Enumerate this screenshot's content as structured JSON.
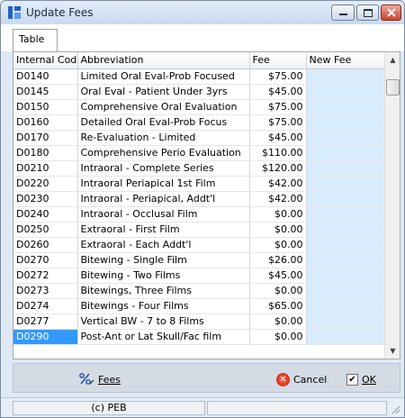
{
  "window": {
    "title": "Update Fees"
  },
  "tabs": [
    {
      "label": "Table"
    }
  ],
  "grid": {
    "columns": [
      "Internal Code",
      "Abbreviation",
      "Fee",
      "New Fee"
    ],
    "rows": [
      {
        "code": "D0140",
        "abbr": "Limited Oral Eval-Prob Focused",
        "fee": "$75.00",
        "new_fee": ""
      },
      {
        "code": "D0145",
        "abbr": "Oral Eval - Patient Under 3yrs",
        "fee": "$45.00",
        "new_fee": ""
      },
      {
        "code": "D0150",
        "abbr": "Comprehensive Oral Evaluation",
        "fee": "$75.00",
        "new_fee": ""
      },
      {
        "code": "D0160",
        "abbr": "Detailed Oral Eval-Prob Focus",
        "fee": "$75.00",
        "new_fee": ""
      },
      {
        "code": "D0170",
        "abbr": "Re-Evaluation - Limited",
        "fee": "$45.00",
        "new_fee": ""
      },
      {
        "code": "D0180",
        "abbr": "Comprehensive Perio Evaluation",
        "fee": "$110.00",
        "new_fee": ""
      },
      {
        "code": "D0210",
        "abbr": "Intraoral - Complete Series",
        "fee": "$120.00",
        "new_fee": ""
      },
      {
        "code": "D0220",
        "abbr": "Intraoral Periapical 1st Film",
        "fee": "$42.00",
        "new_fee": ""
      },
      {
        "code": "D0230",
        "abbr": "Intraoral - Periapical, Addt'l",
        "fee": "$42.00",
        "new_fee": ""
      },
      {
        "code": "D0240",
        "abbr": "Intraoral - Occlusal Film",
        "fee": "$0.00",
        "new_fee": ""
      },
      {
        "code": "D0250",
        "abbr": "Extraoral - First Film",
        "fee": "$0.00",
        "new_fee": ""
      },
      {
        "code": "D0260",
        "abbr": "Extraoral - Each Addt'l",
        "fee": "$0.00",
        "new_fee": ""
      },
      {
        "code": "D0270",
        "abbr": "Bitewing - Single Film",
        "fee": "$26.00",
        "new_fee": ""
      },
      {
        "code": "D0272",
        "abbr": "Bitewing - Two Films",
        "fee": "$45.00",
        "new_fee": ""
      },
      {
        "code": "D0273",
        "abbr": "Bitewings, Three Films",
        "fee": "$0.00",
        "new_fee": ""
      },
      {
        "code": "D0274",
        "abbr": "Bitewings - Four Films",
        "fee": "$65.00",
        "new_fee": ""
      },
      {
        "code": "D0277",
        "abbr": "Vertical BW - 7 to 8 Films",
        "fee": "$0.00",
        "new_fee": ""
      },
      {
        "code": "D0290",
        "abbr": "Post-Ant or Lat Skull/Fac film",
        "fee": "$0.00",
        "new_fee": ""
      }
    ],
    "selected_code": "D0290"
  },
  "toolbar": {
    "fees_label": "Fees",
    "cancel_label": "Cancel",
    "ok_label": "OK"
  },
  "status": {
    "left_text": "(c) PEB",
    "right_text": ""
  },
  "icons": {
    "app": "app-icon",
    "fees": "percent-edit-icon",
    "cancel": "red-x-circle-icon",
    "ok": "checkmark-icon"
  },
  "colors": {
    "selected": "#3399ff",
    "new_fee_cell": "#d9ecfb"
  }
}
